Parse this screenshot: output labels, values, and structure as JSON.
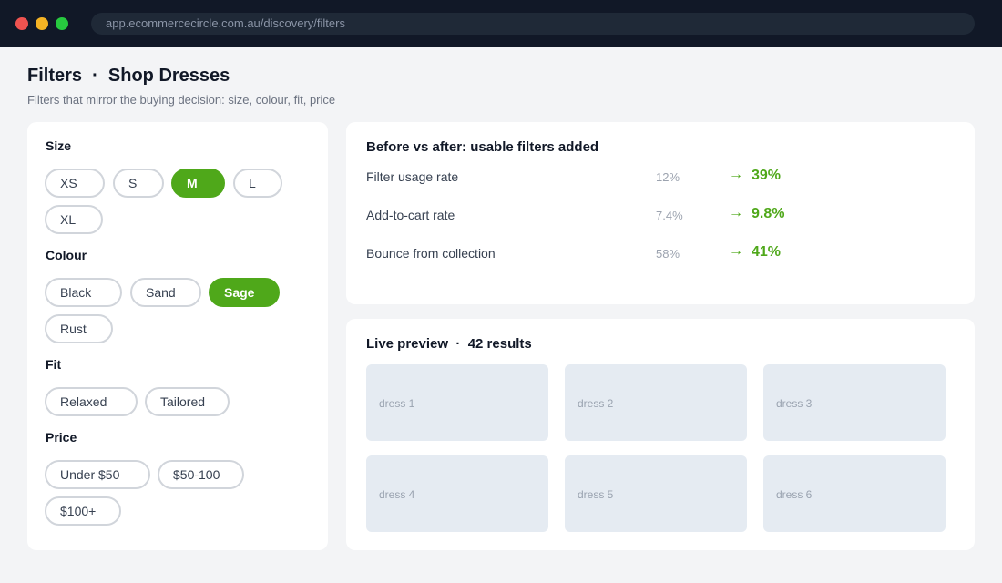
{
  "browser": {
    "url": "app.ecommercecircle.com.au/discovery/filters"
  },
  "header": {
    "title": "Filters  ·  Shop Dresses",
    "subtitle": "Filters that mirror the buying decision: size, colour, fit, price"
  },
  "filters": {
    "groups": [
      {
        "label": "Size",
        "options": [
          {
            "label": "XS",
            "selected": false
          },
          {
            "label": "S",
            "selected": false
          },
          {
            "label": "M",
            "selected": true
          },
          {
            "label": "L",
            "selected": false
          },
          {
            "label": "XL",
            "selected": false
          }
        ]
      },
      {
        "label": "Colour",
        "options": [
          {
            "label": "Black",
            "selected": false
          },
          {
            "label": "Sand",
            "selected": false
          },
          {
            "label": "Sage",
            "selected": true
          },
          {
            "label": "Rust",
            "selected": false
          }
        ]
      },
      {
        "label": "Fit",
        "options": [
          {
            "label": "Relaxed",
            "selected": false
          },
          {
            "label": "Tailored",
            "selected": false
          }
        ]
      },
      {
        "label": "Price",
        "options": [
          {
            "label": "Under $50",
            "selected": false
          },
          {
            "label": "$50-100",
            "selected": false
          },
          {
            "label": "$100+",
            "selected": false
          }
        ]
      }
    ]
  },
  "comparison": {
    "title": "Before vs after: usable filters added",
    "arrow": "→",
    "rows": [
      {
        "label": "Filter usage rate",
        "before": "12%",
        "after": "39%"
      },
      {
        "label": "Add-to-cart rate",
        "before": "7.4%",
        "after": "9.8%"
      },
      {
        "label": "Bounce from collection",
        "before": "58%",
        "after": "41%"
      }
    ]
  },
  "preview": {
    "title": "Live preview  ·  42 results",
    "items": [
      "dress 1",
      "dress 2",
      "dress 3",
      "dress 4",
      "dress 5",
      "dress 6"
    ]
  },
  "colors": {
    "accent": "#4fa81a",
    "chrome": "#111827",
    "background": "#f3f4f6",
    "tile": "#e5ebf2"
  }
}
